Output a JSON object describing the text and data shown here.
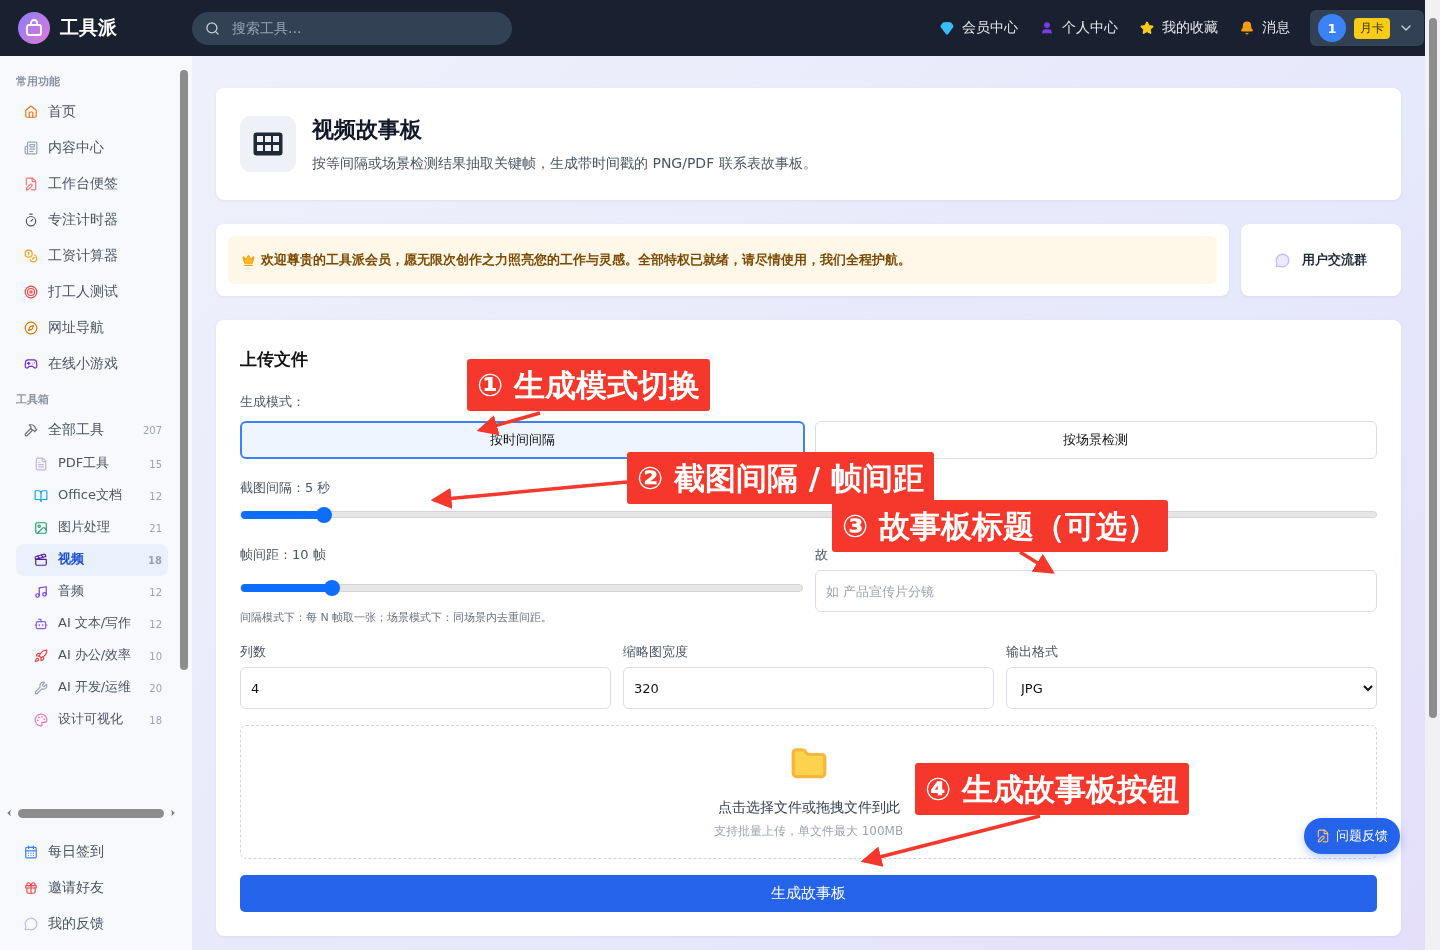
{
  "topbar": {
    "brand": "工具派",
    "search": {
      "placeholder": "搜索工具..."
    },
    "nav": [
      {
        "label": "会员中心"
      },
      {
        "label": "个人中心"
      },
      {
        "label": "我的收藏"
      },
      {
        "label": "消息"
      }
    ],
    "user": {
      "avatar": "1",
      "badge": "月卡"
    }
  },
  "sidebar": {
    "sections": [
      {
        "title": "常用功能",
        "items": [
          {
            "label": "首页",
            "selected": false
          },
          {
            "label": "内容中心",
            "selected": false
          },
          {
            "label": "工作台便签",
            "selected": false
          },
          {
            "label": "专注计时器",
            "selected": false
          },
          {
            "label": "工资计算器",
            "selected": false
          },
          {
            "label": "打工人测试",
            "selected": false
          },
          {
            "label": "网址导航",
            "selected": false
          },
          {
            "label": "在线小游戏",
            "selected": false
          }
        ]
      },
      {
        "title": "工具箱",
        "items": [
          {
            "label": "全部工具",
            "count": "207",
            "selected": false,
            "children": [
              {
                "label": "PDF工具",
                "count": "15",
                "selected": false
              },
              {
                "label": "Office文档",
                "count": "12",
                "selected": false
              },
              {
                "label": "图片处理",
                "count": "21",
                "selected": false
              },
              {
                "label": "视频",
                "count": "18",
                "selected": true
              },
              {
                "label": "音频",
                "count": "12",
                "selected": false
              },
              {
                "label": "AI 文本/写作",
                "count": "12",
                "selected": false
              },
              {
                "label": "AI 办公/效率",
                "count": "10",
                "selected": false
              },
              {
                "label": "AI 开发/运维",
                "count": "20",
                "selected": false
              },
              {
                "label": "设计可视化",
                "count": "18",
                "selected": false
              }
            ]
          }
        ]
      }
    ],
    "footer_items": [
      {
        "label": "每日签到",
        "selected": false
      },
      {
        "label": "邀请好友",
        "selected": false
      },
      {
        "label": "我的反馈",
        "selected": false
      }
    ]
  },
  "header": {
    "title": "视频故事板",
    "subtitle": "按等间隔或场景检测结果抽取关键帧，生成带时间戳的 PNG/PDF 联系表故事板。"
  },
  "notice": {
    "text": "欢迎尊贵的工具派会员，愿无限次创作之力照亮您的工作与灵感。全部特权已就绪，请尽情使用，我们全程护航。",
    "group_button": "用户交流群"
  },
  "form": {
    "title": "上传文件",
    "mode_label": "生成模式：",
    "modes": [
      {
        "label": "按时间间隔",
        "selected": true
      },
      {
        "label": "按场景检测",
        "selected": false
      }
    ],
    "interval": {
      "label": "截图间隔：5 秒",
      "level": 0.073
    },
    "frame_gap": {
      "label": "帧间距：10 帧",
      "level": 0.162
    },
    "hint": "间隔模式下：每 N 帧取一张；场景模式下：同场景内去重间距。",
    "story_title": {
      "label": "故",
      "placeholder": "如 产品宣传片分镜"
    },
    "fields": [
      {
        "kind": "input",
        "label": "列数",
        "value": "4"
      },
      {
        "kind": "input",
        "label": "缩略图宽度",
        "value": "320"
      },
      {
        "kind": "select",
        "label": "输出格式",
        "value": "JPG"
      }
    ],
    "upload": {
      "text": "点击选择文件或拖拽文件到此",
      "subtext": "支持批量上传，单文件最大 100MB"
    },
    "submit": "生成故事板"
  },
  "feedback_button": "问题反馈",
  "annotations": [
    {
      "text": "① 生成模式切换"
    },
    {
      "text": "② 截图间隔 / 帧间距"
    },
    {
      "text": "③ 故事板标题（可选）"
    },
    {
      "text": "④ 生成故事板按钮"
    }
  ]
}
